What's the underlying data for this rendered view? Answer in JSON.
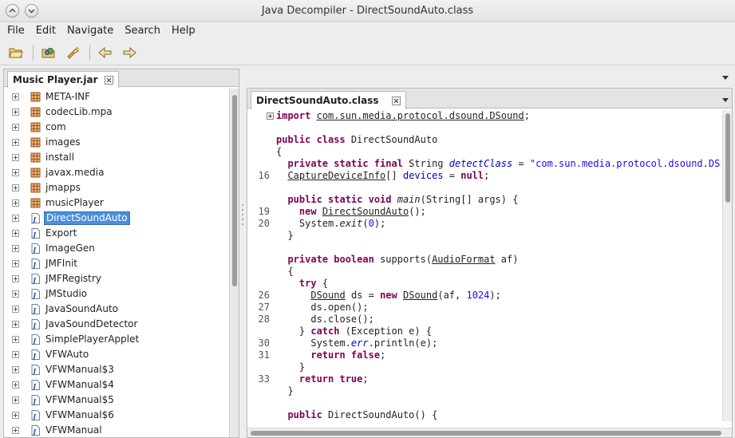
{
  "window": {
    "title": "Java Decompiler - DirectSoundAuto.class"
  },
  "menu": [
    "File",
    "Edit",
    "Navigate",
    "Search",
    "Help"
  ],
  "toolbar": {
    "buttons": [
      "open-folder-icon",
      "open-type-icon",
      "open-type-hierarchy-icon",
      "back-icon",
      "forward-icon"
    ]
  },
  "left_tab": {
    "label": "Music Player.jar"
  },
  "tree": [
    {
      "label": "META-INF",
      "kind": "package"
    },
    {
      "label": "codecLib.mpa",
      "kind": "package"
    },
    {
      "label": "com",
      "kind": "package"
    },
    {
      "label": "images",
      "kind": "package"
    },
    {
      "label": "install",
      "kind": "package"
    },
    {
      "label": "javax.media",
      "kind": "package"
    },
    {
      "label": "jmapps",
      "kind": "package"
    },
    {
      "label": "musicPlayer",
      "kind": "package"
    },
    {
      "label": "DirectSoundAuto",
      "kind": "class",
      "selected": true
    },
    {
      "label": "Export",
      "kind": "class"
    },
    {
      "label": "ImageGen",
      "kind": "class"
    },
    {
      "label": "JMFInit",
      "kind": "class"
    },
    {
      "label": "JMFRegistry",
      "kind": "class"
    },
    {
      "label": "JMStudio",
      "kind": "class"
    },
    {
      "label": "JavaSoundAuto",
      "kind": "class"
    },
    {
      "label": "JavaSoundDetector",
      "kind": "class"
    },
    {
      "label": "SimplePlayerApplet",
      "kind": "class"
    },
    {
      "label": "VFWAuto",
      "kind": "class"
    },
    {
      "label": "VFWManual$3",
      "kind": "class"
    },
    {
      "label": "VFWManual$4",
      "kind": "class"
    },
    {
      "label": "VFWManual$5",
      "kind": "class"
    },
    {
      "label": "VFWManual$6",
      "kind": "class"
    },
    {
      "label": "VFWManual",
      "kind": "class"
    }
  ],
  "editor_tab": {
    "label": "DirectSoundAuto.class"
  },
  "code_lines": [
    {
      "num": "",
      "fold": true,
      "html": "<span class='kw'>import</span> <span class='ul'>com.sun.media.protocol.dsound.DSound</span>;"
    },
    {
      "num": "",
      "html": ""
    },
    {
      "num": "",
      "html": "<span class='kw'>public class</span> DirectSoundAuto"
    },
    {
      "num": "",
      "html": "{"
    },
    {
      "num": "",
      "html": "  <span class='kw'>private static final</span> String <span class='it'>detectClass</span> = <span class='str'>\"com.sun.media.protocol.dsound.DSound\";</span>"
    },
    {
      "num": "16",
      "html": "  <span class='ul'>CaptureDeviceInfo</span>[] <span class='fld'>devices</span> = <span class='kw'>null</span>;"
    },
    {
      "num": "",
      "html": ""
    },
    {
      "num": "",
      "html": "  <span class='kw'>public static void</span> <span class='itb'>main</span>(String[] args) {"
    },
    {
      "num": "19",
      "html": "    <span class='kw'>new</span> <span class='ul'>DirectSoundAuto</span>();"
    },
    {
      "num": "20",
      "html": "    System.<span class='itb'>exit</span>(<span class='num'>0</span>);"
    },
    {
      "num": "",
      "html": "  }"
    },
    {
      "num": "",
      "html": ""
    },
    {
      "num": "",
      "html": "  <span class='kw'>private boolean</span> supports(<span class='ul'>AudioFormat</span> af)"
    },
    {
      "num": "",
      "html": "  {"
    },
    {
      "num": "",
      "html": "    <span class='kw'>try</span> {"
    },
    {
      "num": "26",
      "html": "      <span class='ul'>DSound</span> ds = <span class='kw'>new</span> <span class='ul'>DSound</span>(af, <span class='num'>1024</span>);"
    },
    {
      "num": "27",
      "html": "      ds.open();"
    },
    {
      "num": "28",
      "html": "      ds.close();"
    },
    {
      "num": "",
      "html": "    } <span class='kw'>catch</span> (Exception e) {"
    },
    {
      "num": "30",
      "html": "      System.<span class='it'>err</span>.println(e);"
    },
    {
      "num": "31",
      "html": "      <span class='kw'>return false</span>;"
    },
    {
      "num": "",
      "html": "    }"
    },
    {
      "num": "33",
      "html": "    <span class='kw'>return true</span>;"
    },
    {
      "num": "",
      "html": "  }"
    },
    {
      "num": "",
      "html": ""
    },
    {
      "num": "",
      "html": "  <span class='kw'>public</span> DirectSoundAuto() {"
    }
  ]
}
